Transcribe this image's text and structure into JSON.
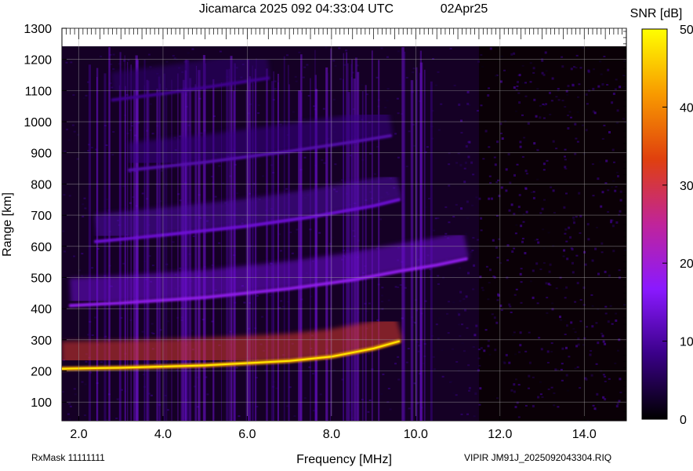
{
  "chart_data": {
    "type": "heatmap",
    "title": "Jicamarca 2025 092 04:33:04 UTC",
    "date_label": "02Apr25",
    "xlabel": "Frequency [MHz]",
    "ylabel": "Range [km]",
    "xlim": [
      1.6,
      15.0
    ],
    "ylim": [
      40,
      1300
    ],
    "x_ticks": [
      "2.0",
      "4.0",
      "6.0",
      "8.0",
      "10.0",
      "12.0",
      "14.0"
    ],
    "x_tick_values": [
      2,
      4,
      6,
      8,
      10,
      12,
      14
    ],
    "y_ticks": [
      "100",
      "200",
      "300",
      "400",
      "500",
      "600",
      "700",
      "800",
      "900",
      "1000",
      "1100",
      "1200",
      "1300"
    ],
    "y_tick_values": [
      100,
      200,
      300,
      400,
      500,
      600,
      700,
      800,
      900,
      1000,
      1100,
      1200,
      1300
    ],
    "grid": true,
    "colorbar": {
      "label": "SNR [dB]",
      "min": 0,
      "max": 50,
      "ticks": [
        "0",
        "10",
        "20",
        "30",
        "40",
        "50"
      ],
      "tick_values": [
        0,
        10,
        20,
        30,
        40,
        50
      ],
      "colors": [
        "#000000",
        "#3a0088",
        "#8a19ff",
        "#c0249a",
        "#e0400e",
        "#f89a00",
        "#ffff00"
      ]
    },
    "traces": [
      {
        "order": 1,
        "snr": 42,
        "x": [
          1.6,
          3,
          5,
          7,
          8,
          9,
          9.6
        ],
        "y": [
          207,
          210,
          218,
          232,
          246,
          272,
          295
        ]
      },
      {
        "order": 2,
        "snr": 18,
        "x": [
          1.8,
          3,
          5,
          7,
          8.5,
          9.6,
          10.5,
          11.2
        ],
        "y": [
          410,
          418,
          436,
          464,
          492,
          520,
          540,
          560
        ]
      },
      {
        "order": 3,
        "snr": 14,
        "x": [
          2.4,
          4,
          6,
          7.5,
          9,
          9.6
        ],
        "y": [
          615,
          636,
          665,
          694,
          730,
          750
        ]
      },
      {
        "order": 4,
        "snr": 11,
        "x": [
          3.2,
          5,
          7,
          8.5,
          9.4
        ],
        "y": [
          845,
          870,
          905,
          935,
          955
        ]
      },
      {
        "order": 5,
        "snr": 9,
        "x": [
          2.8,
          4,
          5.5,
          6.5
        ],
        "y": [
          1070,
          1090,
          1120,
          1140
        ]
      }
    ]
  },
  "footer": {
    "rxmask": "RxMask 11111111",
    "filename": "VIPIR  JM91J_2025092043304.RIQ"
  }
}
